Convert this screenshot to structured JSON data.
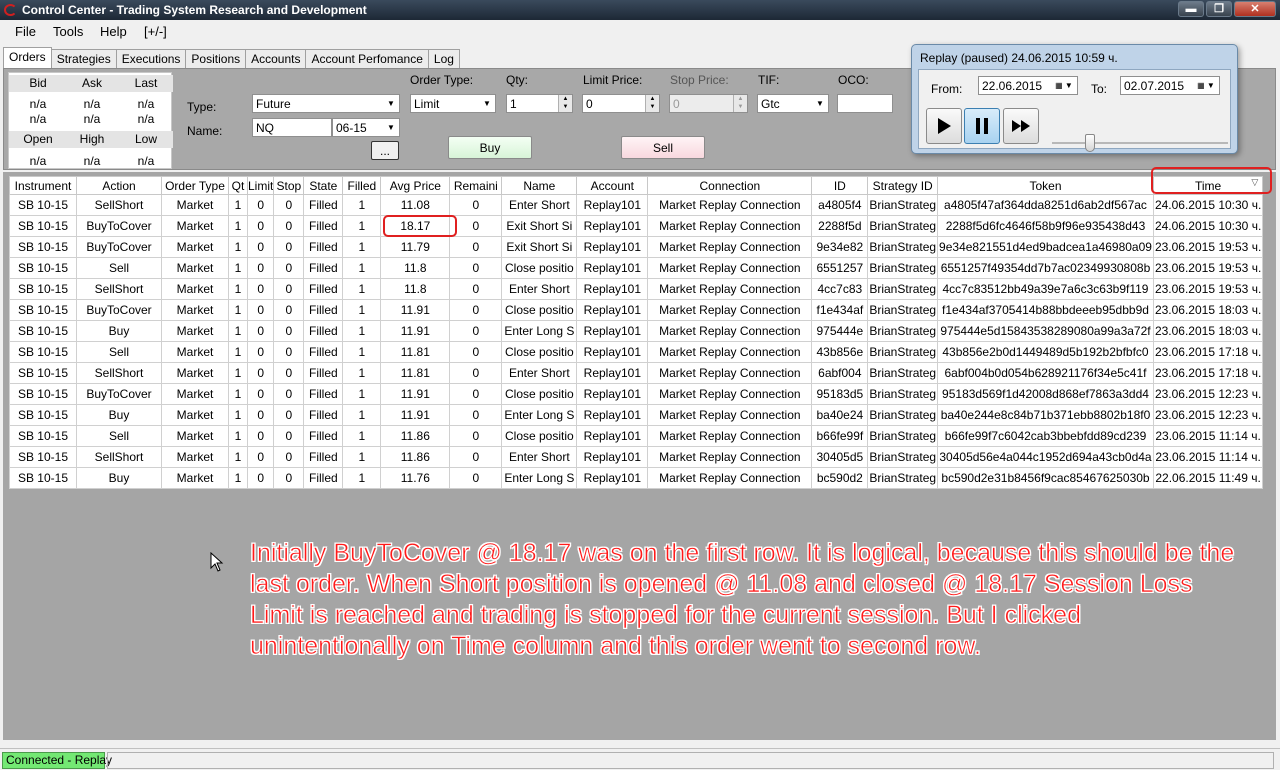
{
  "window": {
    "title": "Control Center - Trading System Research and Development"
  },
  "menu": [
    "File",
    "Tools",
    "Help",
    "[+/-]"
  ],
  "tabs": [
    "Orders",
    "Strategies",
    "Executions",
    "Positions",
    "Accounts",
    "Account Perfomance",
    "Log"
  ],
  "quote": {
    "top_headers": [
      "Bid",
      "Ask",
      "Last"
    ],
    "top_values": [
      "n/a",
      "n/a",
      "n/a"
    ],
    "top_values2": [
      "n/a",
      "n/a",
      "n/a"
    ],
    "bottom_headers": [
      "Open",
      "High",
      "Low"
    ],
    "bottom_values": [
      "n/a",
      "n/a",
      "n/a"
    ]
  },
  "order_form": {
    "type_label": "Type:",
    "type_value": "Future",
    "name_label": "Name:",
    "name_value": "NQ",
    "expiry_value": "06-15",
    "browse_label": "...",
    "order_type_label": "Order Type:",
    "order_type_value": "Limit",
    "qty_label": "Qty:",
    "qty_value": "1",
    "limit_label": "Limit Price:",
    "limit_value": "0",
    "stop_label": "Stop Price:",
    "stop_value": "0",
    "tif_label": "TIF:",
    "tif_value": "Gtc",
    "oco_label": "OCO:",
    "oco_value": "",
    "buy_label": "Buy",
    "sell_label": "Sell"
  },
  "replay": {
    "title": "Replay (paused) 24.06.2015 10:59 ч.",
    "from_label": "From:",
    "from_value": "22.06.2015",
    "to_label": "To:",
    "to_value": "02.07.2015",
    "speed": 0.2
  },
  "grid": {
    "columns": [
      "Instrument",
      "Action",
      "Order Type",
      "Qt",
      "Limit",
      "Stop",
      "State",
      "Filled",
      "Avg Price",
      "Remaini",
      "Name",
      "Account",
      "Connection",
      "ID",
      "Strategy ID",
      "Token",
      "Time"
    ],
    "rows": [
      [
        "SB 10-15",
        "SellShort",
        "Market",
        "1",
        "0",
        "0",
        "Filled",
        "1",
        "11.08",
        "0",
        "Enter Short",
        "Replay101",
        "Market Replay Connection",
        "a4805f4",
        "BrianStrateg",
        "a4805f47af364dda8251d6ab2df567ac",
        "24.06.2015 10:30 ч."
      ],
      [
        "SB 10-15",
        "BuyToCover",
        "Market",
        "1",
        "0",
        "0",
        "Filled",
        "1",
        "18.17",
        "0",
        "Exit Short Si",
        "Replay101",
        "Market Replay Connection",
        "2288f5d",
        "BrianStrateg",
        "2288f5d6fc4646f58b9f96e935438d43",
        "24.06.2015 10:30 ч."
      ],
      [
        "SB 10-15",
        "BuyToCover",
        "Market",
        "1",
        "0",
        "0",
        "Filled",
        "1",
        "11.79",
        "0",
        "Exit Short Si",
        "Replay101",
        "Market Replay Connection",
        "9e34e82",
        "BrianStrateg",
        "9e34e821551d4ed9badcea1a46980a09",
        "23.06.2015 19:53 ч."
      ],
      [
        "SB 10-15",
        "Sell",
        "Market",
        "1",
        "0",
        "0",
        "Filled",
        "1",
        "11.8",
        "0",
        "Close positio",
        "Replay101",
        "Market Replay Connection",
        "6551257",
        "BrianStrateg",
        "6551257f49354dd7b7ac02349930808b",
        "23.06.2015 19:53 ч."
      ],
      [
        "SB 10-15",
        "SellShort",
        "Market",
        "1",
        "0",
        "0",
        "Filled",
        "1",
        "11.8",
        "0",
        "Enter Short",
        "Replay101",
        "Market Replay Connection",
        "4cc7c83",
        "BrianStrateg",
        "4cc7c83512bb49a39e7a6c3c63b9f119",
        "23.06.2015 19:53 ч."
      ],
      [
        "SB 10-15",
        "BuyToCover",
        "Market",
        "1",
        "0",
        "0",
        "Filled",
        "1",
        "11.91",
        "0",
        "Close positio",
        "Replay101",
        "Market Replay Connection",
        "f1e434af",
        "BrianStrateg",
        "f1e434af3705414b88bbdeeeb95dbb9d",
        "23.06.2015 18:03 ч."
      ],
      [
        "SB 10-15",
        "Buy",
        "Market",
        "1",
        "0",
        "0",
        "Filled",
        "1",
        "11.91",
        "0",
        "Enter Long S",
        "Replay101",
        "Market Replay Connection",
        "975444e",
        "BrianStrateg",
        "975444e5d15843538289080a99a3a72f",
        "23.06.2015 18:03 ч."
      ],
      [
        "SB 10-15",
        "Sell",
        "Market",
        "1",
        "0",
        "0",
        "Filled",
        "1",
        "11.81",
        "0",
        "Close positio",
        "Replay101",
        "Market Replay Connection",
        "43b856e",
        "BrianStrateg",
        "43b856e2b0d1449489d5b192b2bfbfc0",
        "23.06.2015 17:18 ч."
      ],
      [
        "SB 10-15",
        "SellShort",
        "Market",
        "1",
        "0",
        "0",
        "Filled",
        "1",
        "11.81",
        "0",
        "Enter Short",
        "Replay101",
        "Market Replay Connection",
        "6abf004",
        "BrianStrateg",
        "6abf004b0d054b628921176f34e5c41f",
        "23.06.2015 17:18 ч."
      ],
      [
        "SB 10-15",
        "BuyToCover",
        "Market",
        "1",
        "0",
        "0",
        "Filled",
        "1",
        "11.91",
        "0",
        "Close positio",
        "Replay101",
        "Market Replay Connection",
        "95183d5",
        "BrianStrateg",
        "95183d569f1d42008d868ef7863a3dd4",
        "23.06.2015 12:23 ч."
      ],
      [
        "SB 10-15",
        "Buy",
        "Market",
        "1",
        "0",
        "0",
        "Filled",
        "1",
        "11.91",
        "0",
        "Enter Long S",
        "Replay101",
        "Market Replay Connection",
        "ba40e24",
        "BrianStrateg",
        "ba40e244e8c84b71b371ebb8802b18f0",
        "23.06.2015 12:23 ч."
      ],
      [
        "SB 10-15",
        "Sell",
        "Market",
        "1",
        "0",
        "0",
        "Filled",
        "1",
        "11.86",
        "0",
        "Close positio",
        "Replay101",
        "Market Replay Connection",
        "b66fe99f",
        "BrianStrateg",
        "b66fe99f7c6042cab3bbebfdd89cd239",
        "23.06.2015 11:14 ч."
      ],
      [
        "SB 10-15",
        "SellShort",
        "Market",
        "1",
        "0",
        "0",
        "Filled",
        "1",
        "11.86",
        "0",
        "Enter Short",
        "Replay101",
        "Market Replay Connection",
        "30405d5",
        "BrianStrateg",
        "30405d56e4a044c1952d694a43cb0d4a",
        "23.06.2015 11:14 ч."
      ],
      [
        "SB 10-15",
        "Buy",
        "Market",
        "1",
        "0",
        "0",
        "Filled",
        "1",
        "11.76",
        "0",
        "Enter Long S",
        "Replay101",
        "Market Replay Connection",
        "bc590d2",
        "BrianStrateg",
        "bc590d2e31b8456f9cac85467625030b",
        "22.06.2015 11:49 ч."
      ]
    ]
  },
  "annotation": "Initially BuyToCover @ 18.17 was on the first row. It is logical, because this should be the last order. When Short position is opened @ 11.08 and closed @ 18.17 Session Loss Limit is reached and trading is stopped for the current session. But I clicked unintentionally on Time column and this order went to second row.",
  "status": {
    "connection": "Connected - Replay"
  },
  "colors": {
    "highlight": "#e02020",
    "annotation": "#ff1a1a",
    "status_ok": "#73e873"
  }
}
